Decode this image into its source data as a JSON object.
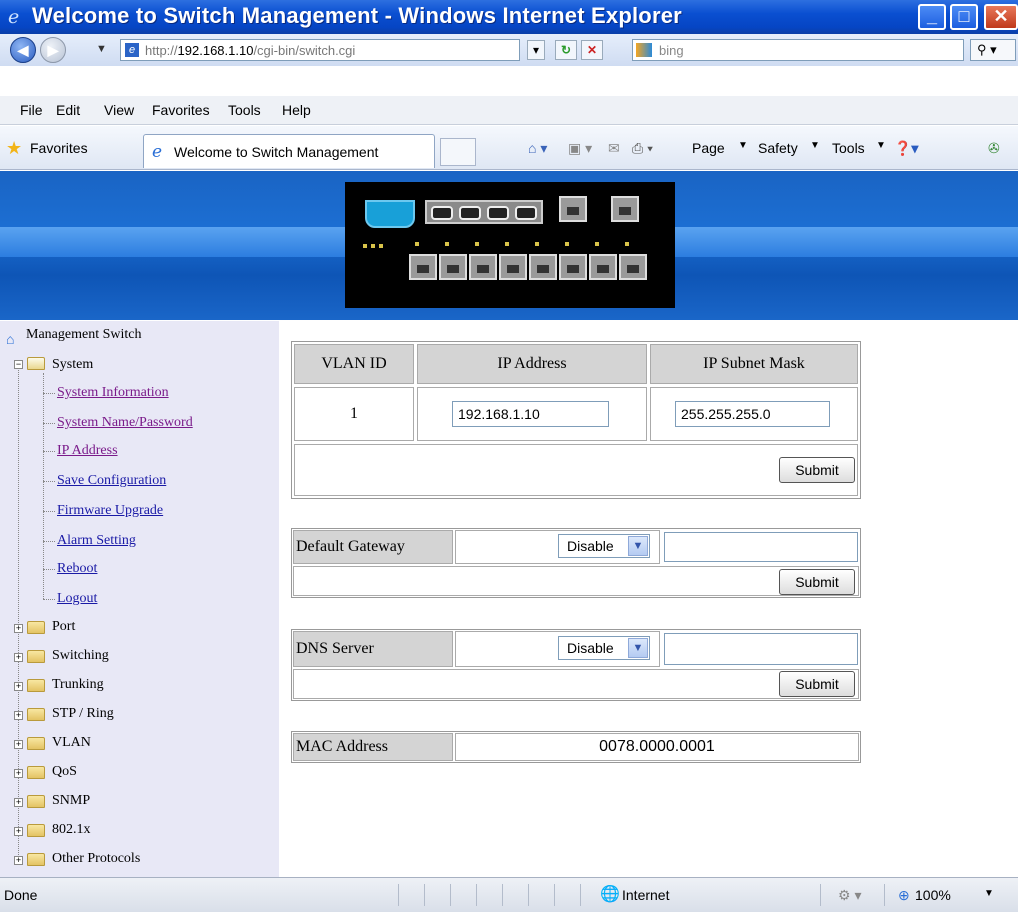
{
  "window": {
    "title": "Welcome to Switch Management - Windows Internet Explorer"
  },
  "address": {
    "prefix": "http://",
    "host": "192.168.1.10",
    "path": "/cgi-bin/switch.cgi",
    "search_placeholder": "bing"
  },
  "menu": [
    "File",
    "Edit",
    "View",
    "Favorites",
    "Tools",
    "Help"
  ],
  "favbar": {
    "favorites": "Favorites",
    "tab_title": "Welcome to Switch Management",
    "page": "Page",
    "safety": "Safety",
    "tools": "Tools"
  },
  "tree": {
    "root": "Management Switch",
    "system": "System",
    "system_items": [
      "System Information",
      "System Name/Password",
      "IP Address",
      "Save Configuration",
      "Firmware Upgrade",
      "Alarm Setting",
      "Reboot",
      "Logout"
    ],
    "folders": [
      "Port",
      "Switching",
      "Trunking",
      "STP / Ring",
      "VLAN",
      "QoS",
      "SNMP",
      "802.1x",
      "Other Protocols"
    ]
  },
  "ip_table": {
    "col_vlan": "VLAN ID",
    "col_ip": "IP Address",
    "col_mask": "IP Subnet Mask",
    "vlan_id": "1",
    "ip": "192.168.1.10",
    "mask": "255.255.255.0",
    "submit": "Submit"
  },
  "gateway": {
    "label": "Default Gateway",
    "select": "Disable",
    "value": "",
    "submit": "Submit"
  },
  "dns": {
    "label": "DNS Server",
    "select": "Disable",
    "value": "",
    "submit": "Submit"
  },
  "mac": {
    "label": "MAC Address",
    "value": "0078.0000.0001"
  },
  "status": {
    "left": "Done",
    "zone": "Internet",
    "zoom": "100%"
  }
}
